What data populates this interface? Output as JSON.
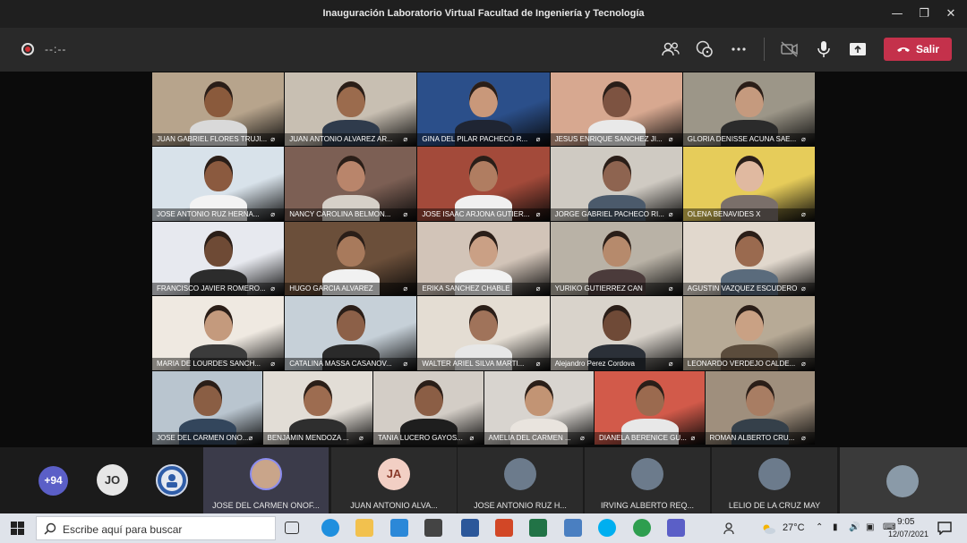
{
  "window": {
    "title": "Inauguración Laboratorio Virtual Facultad de Ingeniería y Tecnología"
  },
  "toolbar": {
    "timer": "--:--",
    "leave_label": "Salir"
  },
  "grid": [
    {
      "name": "JUAN GABRIEL FLORES TRUJI...",
      "bg": "#b7a48c",
      "skin": "#8a5a3c",
      "shirt": "#d9d9d9"
    },
    {
      "name": "JUAN ANTONIO ALVAREZ AR...",
      "bg": "#c8bfb2",
      "skin": "#9b6b4d",
      "shirt": "#2f3b4c"
    },
    {
      "name": "GINA DEL PILAR PACHECO R...",
      "bg": "#2b4f8a",
      "skin": "#c9987a",
      "shirt": "#1f2533"
    },
    {
      "name": "JESUS ENRIQUE SANCHEZ JI...",
      "bg": "#d7a890",
      "skin": "#7d5341",
      "shirt": "#e9e9e9"
    },
    {
      "name": "GLORIA DENISSE ACUNA SAE...",
      "bg": "#9c9688",
      "skin": "#c59a7e",
      "shirt": "#2b2b2b"
    },
    {
      "name": "JOSE ANTONIO RUZ HERNA...",
      "bg": "#d8e2ea",
      "skin": "#8b5a3f",
      "shirt": "#f3f3f3"
    },
    {
      "name": "NANCY CAROLINA BELMON...",
      "bg": "#7c5f54",
      "skin": "#b9856b",
      "shirt": "#d6d0c8"
    },
    {
      "name": "JOSE ISAAC ARJONA GUTIER...",
      "bg": "#a34a3a",
      "skin": "#b07d61",
      "shirt": "#f0f0f0"
    },
    {
      "name": "JORGE GABRIEL PACHECO RI...",
      "bg": "#cfcac2",
      "skin": "#8e6450",
      "shirt": "#4b5a6b"
    },
    {
      "name": "OLENA BENAVIDES X",
      "bg": "#e6cc5a",
      "skin": "#e0b9a0",
      "shirt": "#7a6f6a"
    },
    {
      "name": "FRANCISCO JAVIER ROMERO...",
      "bg": "#e7e9ef",
      "skin": "#6e4a35",
      "shirt": "#2c2c2c"
    },
    {
      "name": "HUGO GARCIA ALVAREZ",
      "bg": "#6b4f3a",
      "skin": "#a87a5c",
      "shirt": "#f1f1f1"
    },
    {
      "name": "ERIKA SANCHEZ CHABLE",
      "bg": "#d2c4b8",
      "skin": "#caa085",
      "shirt": "#f2f2f2"
    },
    {
      "name": "YURIKO GUTIERREZ CAN",
      "bg": "#b9b2a6",
      "skin": "#b68a6c",
      "shirt": "#4b3b3b"
    },
    {
      "name": "AGUSTIN VAZQUEZ ESCUDERO",
      "bg": "#e1d8cd",
      "skin": "#9a6a4f",
      "shirt": "#5a6b7c"
    },
    {
      "name": "MARIA DE LOURDES SANCH...",
      "bg": "#efe9e1",
      "skin": "#c49a7d",
      "shirt": "#3b3b3b"
    },
    {
      "name": "CATALINA MASSA CASANOV...",
      "bg": "#c6d0d8",
      "skin": "#8c6048",
      "shirt": "#2a2a2a"
    },
    {
      "name": "WALTER ARIEL SILVA MARTI...",
      "bg": "#e4ddd3",
      "skin": "#a0735a",
      "shirt": "#e7e7e7"
    },
    {
      "name": "Alejandro Perez Cordova",
      "bg": "#d9d3cb",
      "skin": "#6f4a37",
      "shirt": "#2b3038"
    },
    {
      "name": "LEONARDO VERDEJO CALDE...",
      "bg": "#b7aa96",
      "skin": "#c9a184",
      "shirt": "#5b4c3c"
    },
    {
      "name": "JOSE DEL CARMEN ONO...",
      "bg": "#b9c5cf",
      "skin": "#8a5e44",
      "shirt": "#33465c"
    },
    {
      "name": "BENJAMIN MENDOZA ...",
      "bg": "#e2ddd6",
      "skin": "#9d6c50",
      "shirt": "#2e2e2e"
    },
    {
      "name": "TANIA LUCERO GAYOS...",
      "bg": "#d3cdc6",
      "skin": "#8b5e45",
      "shirt": "#1e1e1e"
    },
    {
      "name": "AMELIA DEL CARMEN ...",
      "bg": "#d8d4cf",
      "skin": "#c29474",
      "shirt": "#e9e4de"
    },
    {
      "name": "DIANELA BERENICE GU...",
      "bg": "#d25a4a",
      "skin": "#9b6a4f",
      "shirt": "#e8e8e8"
    },
    {
      "name": "ROMAN ALBERTO CRU...",
      "bg": "#9f8f7d",
      "skin": "#a87d63",
      "shirt": "#35404a"
    }
  ],
  "strip": {
    "overflow_count": "+94",
    "jo_initials": "JO",
    "participants": [
      {
        "name": "JOSE DEL CARMEN ONOF...",
        "initials": ""
      },
      {
        "name": "JUAN ANTONIO ALVA...",
        "initials": "JA"
      },
      {
        "name": "JOSE ANTONIO RUZ H...",
        "initials": ""
      },
      {
        "name": "IRVING ALBERTO REQ...",
        "initials": ""
      },
      {
        "name": "LELIO DE LA CRUZ MAY",
        "initials": ""
      }
    ]
  },
  "taskbar": {
    "search_placeholder": "Escribe aquí para buscar",
    "temperature": "27°C",
    "time": "9:05",
    "date": "12/07/2021"
  }
}
